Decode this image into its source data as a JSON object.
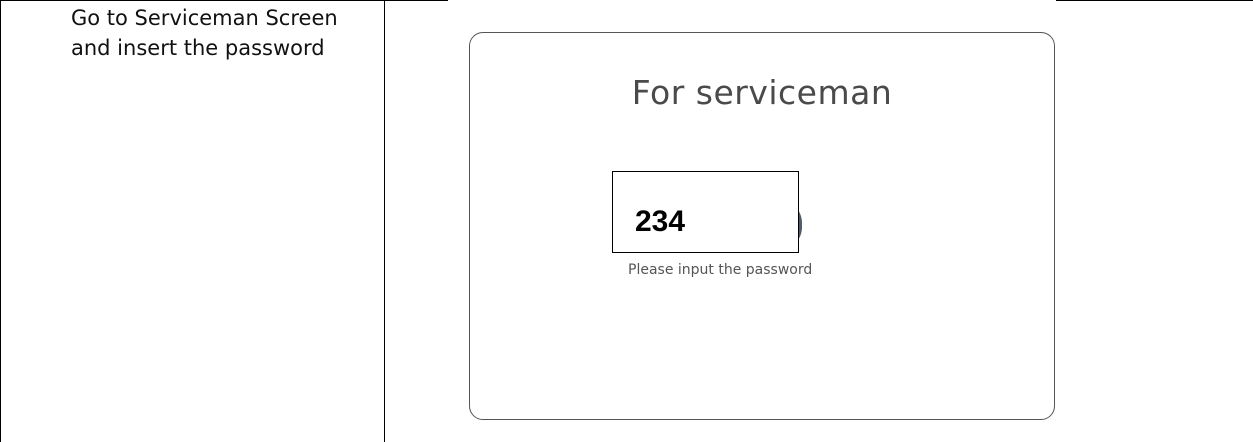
{
  "instruction": {
    "text": "Go to Serviceman Screen and insert the password"
  },
  "panel": {
    "title": "For serviceman",
    "hint": "Please input the password"
  },
  "password_field": {
    "value": "234"
  },
  "colors": {
    "panel_border": "#555555",
    "title_text": "#4a4a4a",
    "button_edge": "#4f5b6b"
  }
}
